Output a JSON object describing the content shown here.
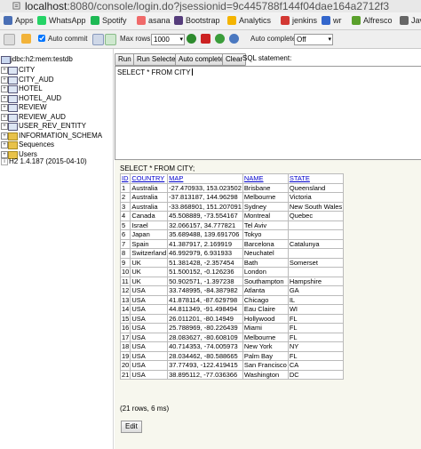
{
  "browser": {
    "url_host": "localhost",
    "url_rest": ":8080/console/login.do?jsessionid=9c445788f144f04dae164a2712f3"
  },
  "bookmarks": [
    {
      "label": "Apps",
      "icon": "apps-grid-icon",
      "color": "#4a6fb5"
    },
    {
      "label": "WhatsApp",
      "icon": "whatsapp-icon",
      "color": "#25d366"
    },
    {
      "label": "Spotify",
      "icon": "spotify-icon",
      "color": "#1db954"
    },
    {
      "label": "asana",
      "icon": "asana-icon",
      "color": "#f06a6a"
    },
    {
      "label": "Bootstrap",
      "icon": "bootstrap-icon",
      "color": "#563d7c"
    },
    {
      "label": "Analytics",
      "icon": "analytics-icon",
      "color": "#f4b400"
    },
    {
      "label": "jenkins",
      "icon": "jenkins-icon",
      "color": "#d33833"
    },
    {
      "label": "wr",
      "icon": "wr-icon",
      "color": "#3366cc"
    },
    {
      "label": "Alfresco",
      "icon": "alfresco-icon",
      "color": "#5aa02c"
    },
    {
      "label": "Jav",
      "icon": "java-icon",
      "color": "#666666"
    }
  ],
  "toolbar": {
    "auto_commit_label": "Auto commit",
    "auto_commit_checked": true,
    "max_rows_label": "Max rows:",
    "max_rows_value": "1000",
    "auto_complete_label": "Auto complete",
    "auto_complete_value": "Off"
  },
  "tree": {
    "connection": "jdbc:h2:mem:testdb",
    "items": [
      {
        "label": "CITY",
        "type": "table"
      },
      {
        "label": "CITY_AUD",
        "type": "table"
      },
      {
        "label": "HOTEL",
        "type": "table"
      },
      {
        "label": "HOTEL_AUD",
        "type": "table"
      },
      {
        "label": "REVIEW",
        "type": "table"
      },
      {
        "label": "REVIEW_AUD",
        "type": "table"
      },
      {
        "label": "USER_REV_ENTITY",
        "type": "table"
      },
      {
        "label": "INFORMATION_SCHEMA",
        "type": "folder"
      },
      {
        "label": "Sequences",
        "type": "folder"
      },
      {
        "label": "Users",
        "type": "folder"
      }
    ],
    "version": "H2 1.4.187 (2015-04-10)"
  },
  "sql_buttons": {
    "run": "Run",
    "run_selected": "Run Selected",
    "auto_complete": "Auto complete",
    "clear": "Clear",
    "statement_label": "SQL statement:"
  },
  "editor": {
    "text": "SELECT * FROM CITY"
  },
  "results": {
    "title": "SELECT * FROM CITY;",
    "columns": [
      "ID",
      "COUNTRY",
      "MAP",
      "NAME",
      "STATE"
    ],
    "rows": [
      [
        "1",
        "Australia",
        "-27.470933, 153.023502",
        "Brisbane",
        "Queensland"
      ],
      [
        "2",
        "Australia",
        "-37.813187, 144.96298",
        "Melbourne",
        "Victoria"
      ],
      [
        "3",
        "Australia",
        "-33.868901, 151.207091",
        "Sydney",
        "New South Wales"
      ],
      [
        "4",
        "Canada",
        "45.508889, -73.554167",
        "Montreal",
        "Quebec"
      ],
      [
        "5",
        "Israel",
        "32.066157, 34.777821",
        "Tel Aviv",
        ""
      ],
      [
        "6",
        "Japan",
        "35.689488, 139.691706",
        "Tokyo",
        ""
      ],
      [
        "7",
        "Spain",
        "41.387917, 2.169919",
        "Barcelona",
        "Catalunya"
      ],
      [
        "8",
        "Switzerland",
        "46.992979, 6.931933",
        "Neuchatel",
        ""
      ],
      [
        "9",
        "UK",
        "51.381428, -2.357454",
        "Bath",
        "Somerset"
      ],
      [
        "10",
        "UK",
        "51.500152, -0.126236",
        "London",
        ""
      ],
      [
        "11",
        "UK",
        "50.902571, -1.397238",
        "Southampton",
        "Hampshire"
      ],
      [
        "12",
        "USA",
        "33.748995, -84.387982",
        "Atlanta",
        "GA"
      ],
      [
        "13",
        "USA",
        "41.878114, -87.629798",
        "Chicago",
        "IL"
      ],
      [
        "14",
        "USA",
        "44.811349, -91.498494",
        "Eau Claire",
        "WI"
      ],
      [
        "15",
        "USA",
        "26.011201, -80.14949",
        "Hollywood",
        "FL"
      ],
      [
        "16",
        "USA",
        "25.788969, -80.226439",
        "Miami",
        "FL"
      ],
      [
        "17",
        "USA",
        "28.083627, -80.608109",
        "Melbourne",
        "FL"
      ],
      [
        "18",
        "USA",
        "40.714353, -74.005973",
        "New York",
        "NY"
      ],
      [
        "19",
        "USA",
        "28.034462, -80.588665",
        "Palm Bay",
        "FL"
      ],
      [
        "20",
        "USA",
        "37.77493, -122.419415",
        "San Francisco",
        "CA"
      ],
      [
        "21",
        "USA",
        "38.895112, -77.036366",
        "Washington",
        "DC"
      ]
    ],
    "row_count": "(21 rows, 6 ms)",
    "edit_label": "Edit"
  }
}
